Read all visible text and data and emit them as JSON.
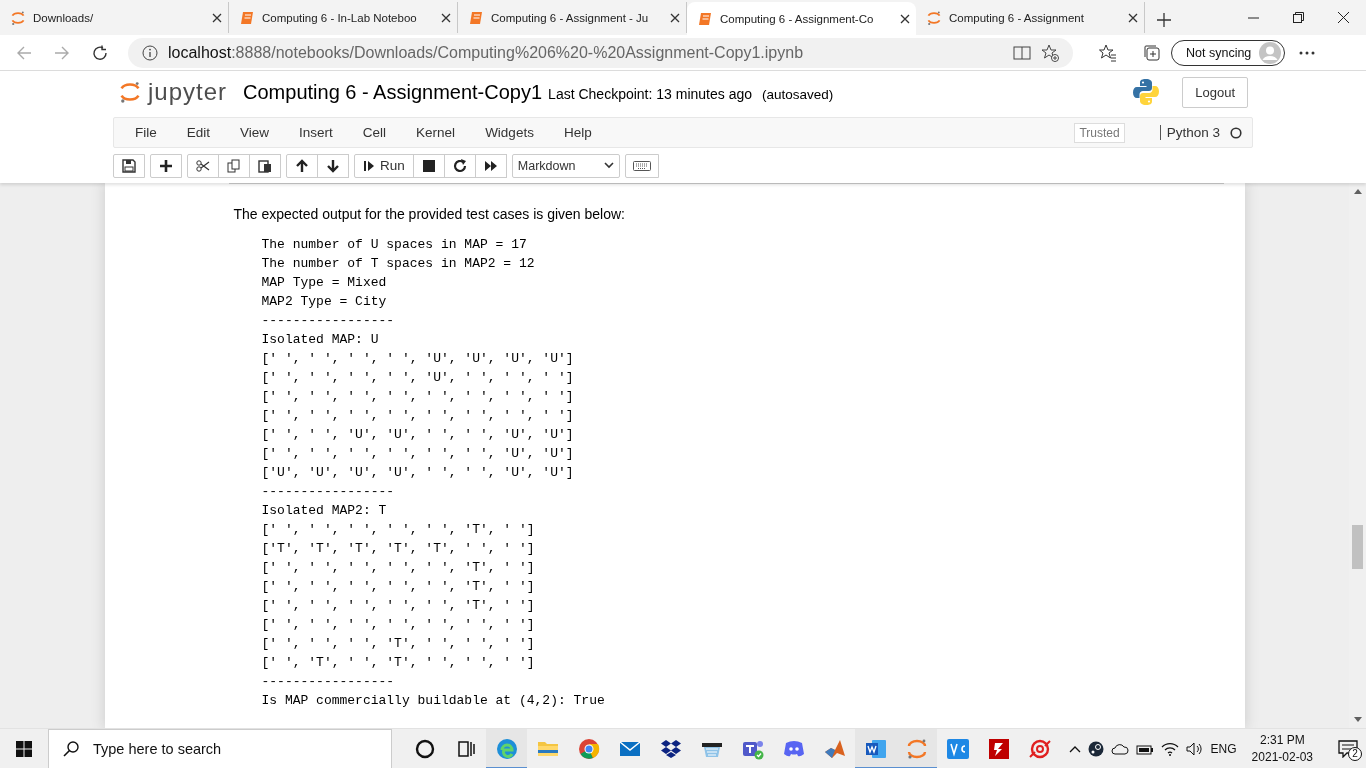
{
  "browser": {
    "tabs": [
      {
        "title": "Downloads/",
        "kind": "jupyter",
        "selected": false
      },
      {
        "title": "Computing 6 - In-Lab Noteboo",
        "kind": "notebook",
        "selected": false
      },
      {
        "title": "Computing 6 - Assignment - Ju",
        "kind": "notebook",
        "selected": false
      },
      {
        "title": "Computing 6 - Assignment-Co",
        "kind": "notebook",
        "selected": true
      },
      {
        "title": "Computing 6 - Assignment",
        "kind": "jupyter",
        "selected": false
      }
    ],
    "url_host": "localhost",
    "url_path": ":8888/notebooks/Downloads/Computing%206%20-%20Assignment-Copy1.ipynb",
    "profile": "Not syncing"
  },
  "jupyter": {
    "logo": "jupyter",
    "notebook_name": "Computing 6 - Assignment-Copy1",
    "checkpoint": "Last Checkpoint: 13 minutes ago",
    "autosave": "(autosaved)",
    "logout": "Logout",
    "menus": [
      "File",
      "Edit",
      "View",
      "Insert",
      "Cell",
      "Kernel",
      "Widgets",
      "Help"
    ],
    "trusted": "Trusted",
    "kernel": "Python 3",
    "kernel_busy": false,
    "toolbar": [
      [
        {
          "kind": "save"
        }
      ],
      [
        {
          "kind": "insert"
        }
      ],
      [
        {
          "kind": "cut"
        },
        {
          "kind": "copy"
        },
        {
          "kind": "paste"
        }
      ],
      [
        {
          "kind": "up"
        },
        {
          "kind": "down"
        }
      ],
      [
        {
          "kind": "run",
          "label": "Run"
        },
        {
          "kind": "stop"
        },
        {
          "kind": "restart"
        },
        {
          "kind": "fastforward"
        }
      ],
      [
        {
          "kind": "select",
          "value": "Markdown"
        }
      ],
      [
        {
          "kind": "keyboard"
        }
      ]
    ]
  },
  "cell": {
    "text": "The expected output for the provided test cases is given below:",
    "output": [
      "The number of U spaces in MAP = 17",
      "The number of T spaces in MAP2 = 12",
      "MAP Type = Mixed",
      "MAP2 Type = City",
      "-----------------",
      "Isolated MAP: U",
      "[' ', ' ', ' ', ' ', 'U', 'U', 'U', 'U']",
      "[' ', ' ', ' ', ' ', 'U', ' ', ' ', ' ']",
      "[' ', ' ', ' ', ' ', ' ', ' ', ' ', ' ']",
      "[' ', ' ', ' ', ' ', ' ', ' ', ' ', ' ']",
      "[' ', ' ', 'U', 'U', ' ', ' ', 'U', 'U']",
      "[' ', ' ', ' ', ' ', ' ', ' ', 'U', 'U']",
      "['U', 'U', 'U', 'U', ' ', ' ', 'U', 'U']",
      "-----------------",
      "Isolated MAP2: T",
      "[' ', ' ', ' ', ' ', ' ', 'T', ' ']",
      "['T', 'T', 'T', 'T', 'T', ' ', ' ']",
      "[' ', ' ', ' ', ' ', ' ', 'T', ' ']",
      "[' ', ' ', ' ', ' ', ' ', 'T', ' ']",
      "[' ', ' ', ' ', ' ', ' ', 'T', ' ']",
      "[' ', ' ', ' ', ' ', ' ', ' ', ' ']",
      "[' ', ' ', ' ', 'T', ' ', ' ', ' ']",
      "[' ', 'T', ' ', 'T', ' ', ' ', ' ']",
      "-----------------",
      "Is MAP commercially buildable at (4,2): True"
    ]
  },
  "taskbar": {
    "search_placeholder": "Type here to search",
    "apps": [
      {
        "kind": "cortana",
        "running": false
      },
      {
        "kind": "taskview",
        "running": false
      },
      {
        "kind": "edge",
        "running": true
      },
      {
        "kind": "folder",
        "running": false
      },
      {
        "kind": "chrome",
        "running": false
      },
      {
        "kind": "mail",
        "running": false
      },
      {
        "kind": "dropbox",
        "running": false
      },
      {
        "kind": "shop",
        "running": false
      },
      {
        "kind": "teams",
        "running": false
      },
      {
        "kind": "discord",
        "running": false
      },
      {
        "kind": "matlab",
        "running": false
      },
      {
        "kind": "word",
        "running": true
      },
      {
        "kind": "jupyter",
        "running": true
      },
      {
        "kind": "vscode",
        "running": false
      },
      {
        "kind": "filezilla",
        "running": false
      },
      {
        "kind": "lifebuoy",
        "running": false
      }
    ],
    "language": "ENG",
    "time": "2:31 PM",
    "date": "2021-02-03",
    "notifications": "2"
  }
}
